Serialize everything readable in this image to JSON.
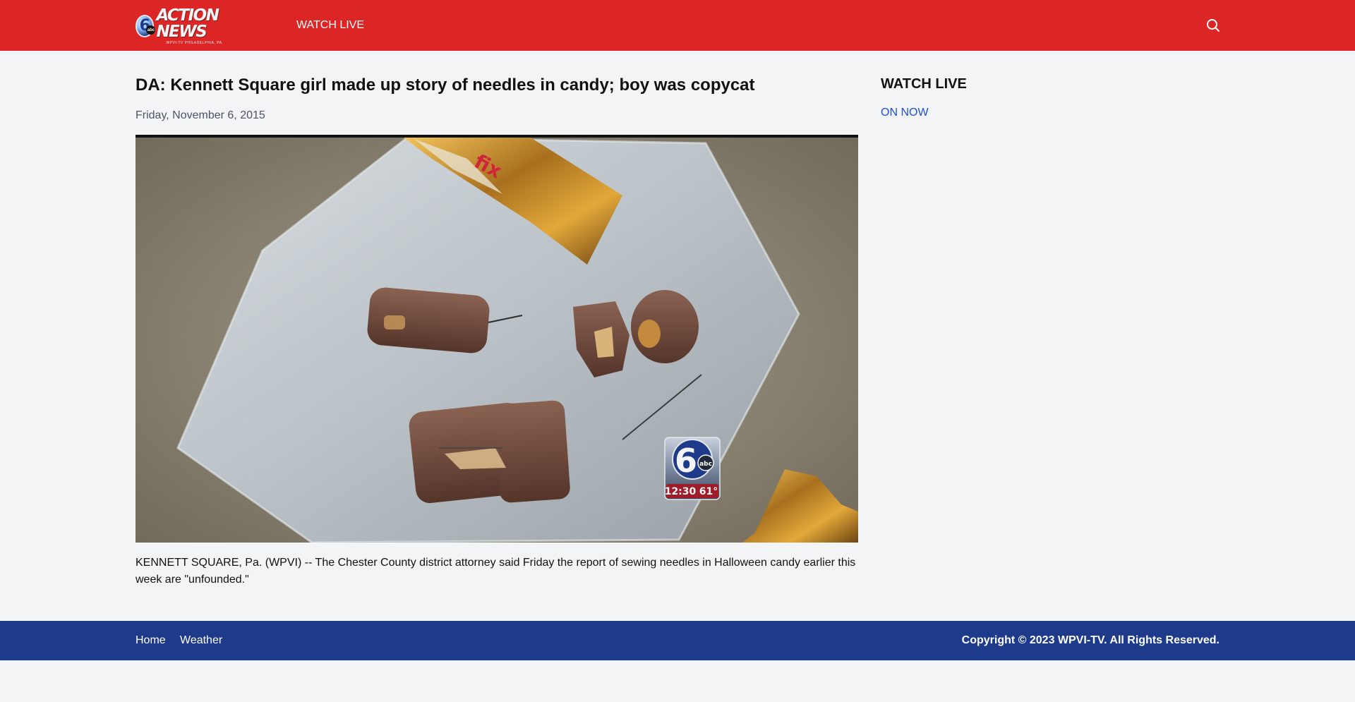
{
  "header": {
    "logo_text": "ACTION NEWS",
    "logo_subtext": "WPVI-TV PHILADELPHIA, PA",
    "logo_number": "6",
    "logo_abc": "abc",
    "nav_watch_live": "WATCH LIVE",
    "search_icon": "search-icon",
    "background_color": "#dc2626"
  },
  "article": {
    "headline": "DA: Kennett Square girl made up story of needles in candy; boy was copycat",
    "date": "Friday, November 6, 2015",
    "image_bug_time": "12:30",
    "image_bug_temp": "61°",
    "body": "KENNETT SQUARE, Pa. (WPVI) -- The Chester County district attorney said Friday the report of sewing needles in Halloween candy earlier this week are \"unfounded.\""
  },
  "sidebar": {
    "title": "WATCH LIVE",
    "link": "ON NOW",
    "link_color": "#1d4ed8"
  },
  "footer": {
    "links": [
      "Home",
      "Weather"
    ],
    "copyright": "Copyright © 2023 WPVI-TV. All Rights Reserved.",
    "background_color": "#1e3a8a"
  }
}
